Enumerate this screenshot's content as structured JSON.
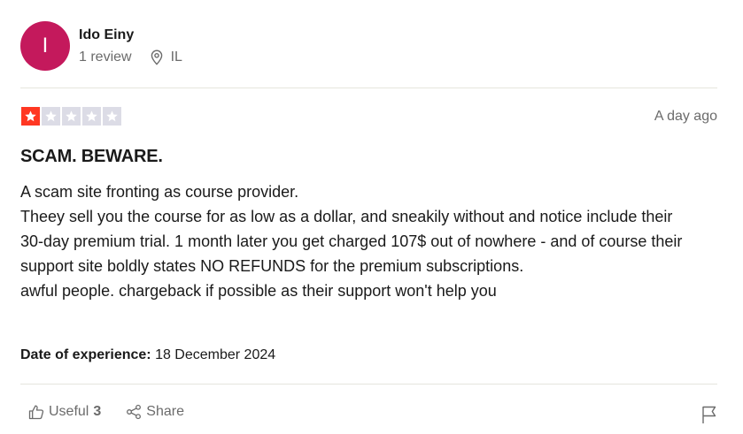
{
  "reviewer": {
    "initial": "I",
    "name": "Ido Einy",
    "review_count": "1 review",
    "location": "IL",
    "avatar_color": "#c4195c"
  },
  "review": {
    "rating": 1,
    "max_rating": 5,
    "star_color": "#ff3722",
    "posted": "A day ago",
    "title": "SCAM. BEWARE.",
    "body_lines": [
      "A scam site fronting as course provider.",
      "Theey sell you the course for as low as a dollar, and sneakily without and notice include their 30-day premium trial. 1 month later you get charged 107$ out of nowhere - and of course their support site boldly states NO REFUNDS for the premium subscriptions.",
      "awful people. chargeback if possible as their support won't help you"
    ],
    "experience_label": "Date of experience:",
    "experience_date": "18 December 2024"
  },
  "actions": {
    "useful_label": "Useful",
    "useful_count": "3",
    "share_label": "Share"
  },
  "icons": {
    "location": "map-pin-icon",
    "useful": "thumbs-up-icon",
    "share": "share-icon",
    "report": "flag-icon",
    "star": "star-icon"
  }
}
